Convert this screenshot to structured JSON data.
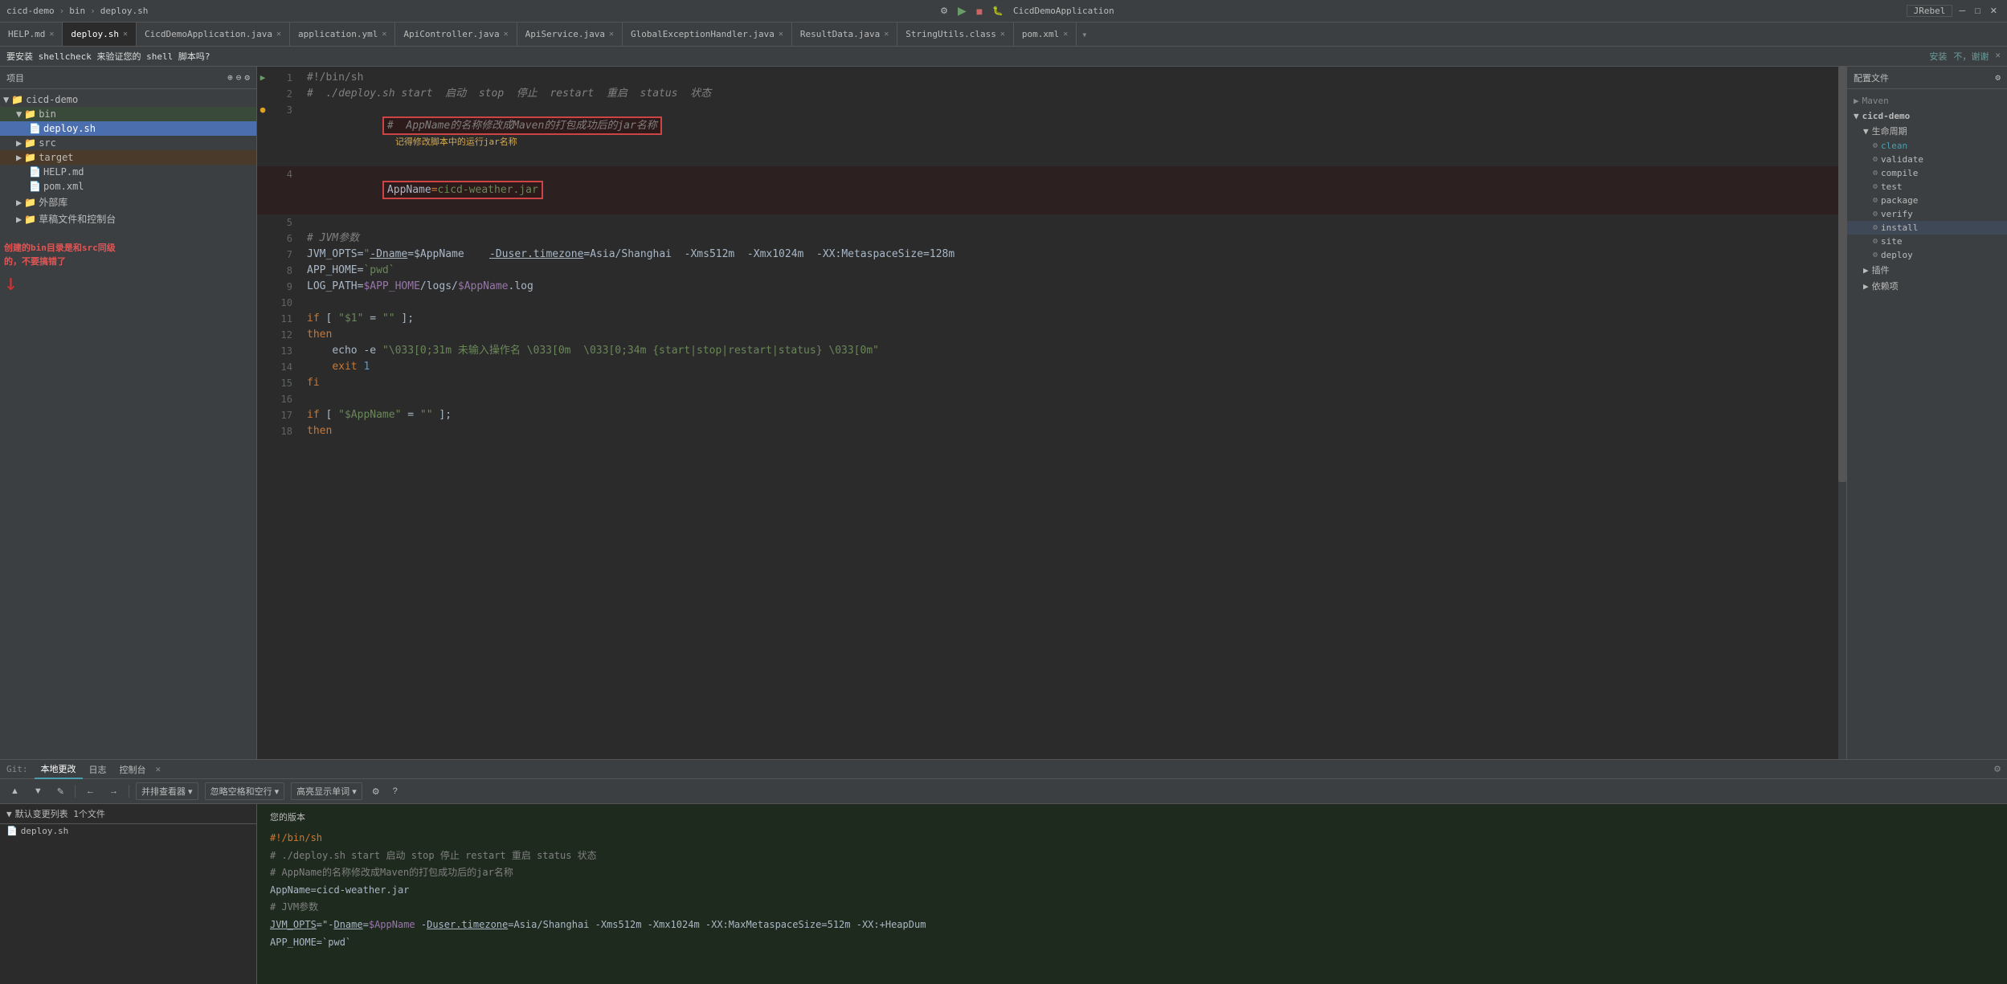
{
  "titleBar": {
    "projectName": "cicd-demo",
    "breadcrumb1": "bin",
    "breadcrumb2": "deploy.sh",
    "appName": "CicdDemoApplication",
    "jrebel": "JRebel"
  },
  "tabs": [
    {
      "label": "HELP.md",
      "active": false,
      "modified": false
    },
    {
      "label": "deploy.sh",
      "active": true,
      "modified": false
    },
    {
      "label": "CicdDemoApplication.java",
      "active": false,
      "modified": false
    },
    {
      "label": "application.yml",
      "active": false,
      "modified": false
    },
    {
      "label": "ApiController.java",
      "active": false,
      "modified": false
    },
    {
      "label": "ApiService.java",
      "active": false,
      "modified": false
    },
    {
      "label": "GlobalExceptionHandler.java",
      "active": false,
      "modified": false
    },
    {
      "label": "ResultData.java",
      "active": false,
      "modified": false
    },
    {
      "label": "StringUtils.class",
      "active": false,
      "modified": false
    },
    {
      "label": "pom.xml",
      "active": false,
      "modified": false
    }
  ],
  "notification": {
    "text": "要安装 shellcheck 来验证您的 shell 脚本吗?",
    "action1": "安装",
    "action2": "不，谢谢"
  },
  "sidebar": {
    "title": "项目",
    "tree": [
      {
        "level": 0,
        "type": "folder",
        "label": "cicd-demo",
        "expanded": true
      },
      {
        "level": 1,
        "type": "folder",
        "label": "bin",
        "expanded": true,
        "highlighted": true
      },
      {
        "level": 2,
        "type": "sh",
        "label": "deploy.sh",
        "selected": true
      },
      {
        "level": 1,
        "type": "folder",
        "label": "src",
        "expanded": false
      },
      {
        "level": 1,
        "type": "folder",
        "label": "target",
        "expanded": false,
        "highlighted": true
      },
      {
        "level": 2,
        "type": "md",
        "label": "HELP.md"
      },
      {
        "level": 2,
        "type": "xml",
        "label": "pom.xml"
      },
      {
        "level": 1,
        "type": "folder",
        "label": "外部库",
        "expanded": false
      },
      {
        "level": 1,
        "type": "folder",
        "label": "草稿文件和控制台",
        "expanded": false
      }
    ]
  },
  "annotation": {
    "text": "创建的bin目录是和src同级的，不要搞错了"
  },
  "codeLines": [
    {
      "num": 1,
      "content": "#!/bin/sh",
      "type": "shebang",
      "hasRun": true
    },
    {
      "num": 2,
      "content": "#  ./deploy.sh start  启动  stop  停止  restart  重启  status  状态",
      "type": "comment"
    },
    {
      "num": 3,
      "content": "#  AppName的名称修改成Maven的打包成功后的jar名称",
      "type": "comment-highlight",
      "warn": "记得修改脚本中的运行jar名称"
    },
    {
      "num": 4,
      "content": "AppName=cicd-weather.jar",
      "type": "var-assign",
      "highlighted": true
    },
    {
      "num": 5,
      "content": "",
      "type": "empty"
    },
    {
      "num": 6,
      "content": "# JVM参数",
      "type": "comment"
    },
    {
      "num": 7,
      "content": "JVM_OPTS=\"-Dname=$AppName    -Duser.timezone=Asia/Shanghai  -Xms512m  -Xmx1024m  -XX:MetaspaceSize=128m",
      "type": "var-assign-long"
    },
    {
      "num": 8,
      "content": "APP_HOME=`pwd`",
      "type": "var-assign"
    },
    {
      "num": 9,
      "content": "LOG_PATH=$APP_HOME/logs/$AppName.log",
      "type": "var-assign"
    },
    {
      "num": 10,
      "content": "",
      "type": "empty"
    },
    {
      "num": 11,
      "content": "if [ \"$1\" = \"\" ];",
      "type": "keyword"
    },
    {
      "num": 12,
      "content": "then",
      "type": "keyword"
    },
    {
      "num": 13,
      "content": "    echo -e \"\\033[0;31m 未输入操作名 \\033[0m  \\033[0;34m {start|stop|restart|status} \\033[0m\"",
      "type": "echo"
    },
    {
      "num": 14,
      "content": "    exit 1",
      "type": "exit"
    },
    {
      "num": 15,
      "content": "fi",
      "type": "keyword"
    },
    {
      "num": 16,
      "content": "",
      "type": "empty"
    },
    {
      "num": 17,
      "content": "if [ \"$AppName\" = \"\" ];",
      "type": "keyword"
    },
    {
      "num": 18,
      "content": "then",
      "type": "keyword"
    }
  ],
  "rightPanel": {
    "title": "配置文件",
    "mavenTitle": "Maven",
    "sections": [
      {
        "label": "cicd-demo",
        "level": 0,
        "expanded": true
      },
      {
        "label": "生命周期",
        "level": 1,
        "expanded": true
      },
      {
        "label": "clean",
        "level": 2,
        "active": true
      },
      {
        "label": "validate",
        "level": 2
      },
      {
        "label": "compile",
        "level": 2
      },
      {
        "label": "test",
        "level": 2
      },
      {
        "label": "package",
        "level": 2
      },
      {
        "label": "verify",
        "level": 2
      },
      {
        "label": "install",
        "level": 2,
        "highlighted": true
      },
      {
        "label": "site",
        "level": 2
      },
      {
        "label": "deploy",
        "level": 2
      },
      {
        "label": "插件",
        "level": 1,
        "expanded": false
      },
      {
        "label": "依赖项",
        "level": 1,
        "expanded": false
      }
    ]
  },
  "bottomPanel": {
    "tabs": [
      "本地更改",
      "日志",
      "控制台"
    ],
    "activeTab": "本地更改",
    "diffHeader": "默认变更列表 1个文件",
    "diffFile": "deploy.sh",
    "yourVersion": "您的版本",
    "diffLines": [
      {
        "content": "#!/bin/sh",
        "type": "normal"
      },
      {
        "content": "# ./deploy.sh start  启动  stop  停止  restart  重启  status  状态",
        "type": "normal"
      },
      {
        "content": "# AppName的名称修改成Maven的打包成功后的jar名称",
        "type": "comment"
      },
      {
        "content": "AppName=cicd-weather.jar",
        "type": "normal"
      },
      {
        "content": "",
        "type": "empty"
      },
      {
        "content": "# JVM参数",
        "type": "comment"
      },
      {
        "content": "JVM_OPTS=\"-Dname=$AppName    -Duser.timezone=Asia/Shanghai  -Xms512m  -Xmx1024m  -XX:MaxMetaspaceSize=512m  -XX:+HeapDum",
        "type": "normal"
      },
      {
        "content": "APP_HOME=`pwd`",
        "type": "normal"
      }
    ]
  },
  "bottomToolbar": {
    "upBtn": "▲",
    "downBtn": "▼",
    "editBtn": "✎",
    "backBtn": "←",
    "forwardBtn": "→",
    "compareBtn": "并排查看器 ▾",
    "ignoreBtn": "忽略空格和空行 ▾",
    "highlightBtn": "高亮显示单词 ▾",
    "settingsBtn": "⚙",
    "helpBtn": "?"
  },
  "git": {
    "label": "Git:"
  }
}
